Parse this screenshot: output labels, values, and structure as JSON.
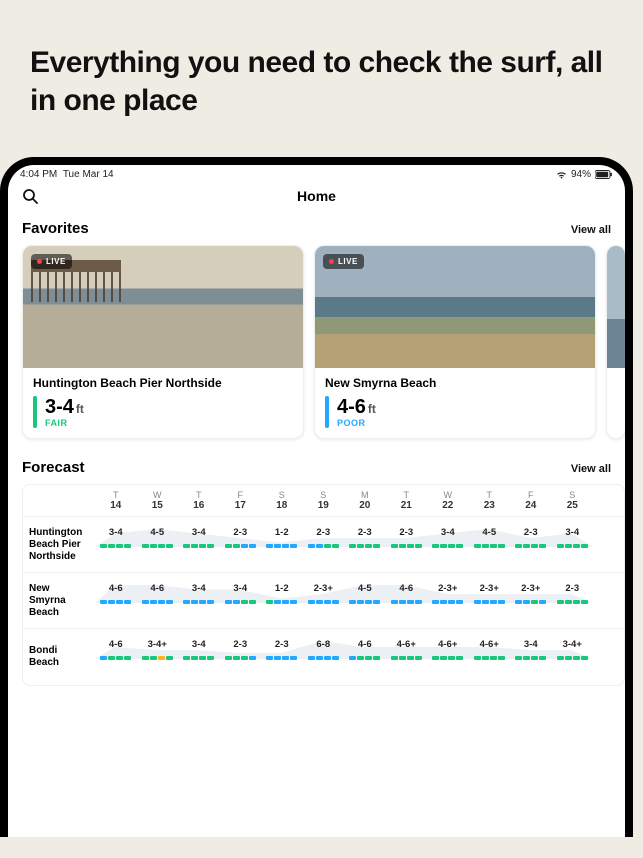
{
  "headline": "Everything you need to check the surf, all in one place",
  "status": {
    "time": "4:04 PM",
    "date": "Tue Mar 14",
    "battery": "94%"
  },
  "nav": {
    "title": "Home"
  },
  "favorites": {
    "title": "Favorites",
    "view_all": "View all",
    "live_label": "LIVE",
    "cards": [
      {
        "name": "Huntington Beach Pier Northside",
        "height": "3-4",
        "unit": "ft",
        "condition": "FAIR",
        "cond_key": "fair"
      },
      {
        "name": "New Smyrna Beach",
        "height": "4-6",
        "unit": "ft",
        "condition": "POOR",
        "cond_key": "poor"
      }
    ]
  },
  "forecast": {
    "title": "Forecast",
    "view_all": "View all",
    "days": [
      {
        "dow": "T",
        "dom": "14"
      },
      {
        "dow": "W",
        "dom": "15"
      },
      {
        "dow": "T",
        "dom": "16"
      },
      {
        "dow": "F",
        "dom": "17"
      },
      {
        "dow": "S",
        "dom": "18"
      },
      {
        "dow": "S",
        "dom": "19"
      },
      {
        "dow": "M",
        "dom": "20"
      },
      {
        "dow": "T",
        "dom": "21"
      },
      {
        "dow": "W",
        "dom": "22"
      },
      {
        "dow": "T",
        "dom": "23"
      },
      {
        "dow": "F",
        "dom": "24"
      },
      {
        "dow": "S",
        "dom": "25"
      }
    ],
    "spots": [
      {
        "name": "Huntington Beach Pier Northside",
        "cells": [
          {
            "v": "3-4",
            "c": [
              "g",
              "g",
              "g",
              "g"
            ]
          },
          {
            "v": "4-5",
            "c": [
              "g",
              "g",
              "g",
              "g"
            ]
          },
          {
            "v": "3-4",
            "c": [
              "g",
              "g",
              "g",
              "g"
            ]
          },
          {
            "v": "2-3",
            "c": [
              "g",
              "g",
              "b",
              "b"
            ]
          },
          {
            "v": "1-2",
            "c": [
              "b",
              "b",
              "b",
              "b"
            ]
          },
          {
            "v": "2-3",
            "c": [
              "b",
              "b",
              "g",
              "g"
            ]
          },
          {
            "v": "2-3",
            "c": [
              "g",
              "g",
              "g",
              "g"
            ]
          },
          {
            "v": "2-3",
            "c": [
              "g",
              "g",
              "g",
              "g"
            ]
          },
          {
            "v": "3-4",
            "c": [
              "g",
              "g",
              "g",
              "g"
            ]
          },
          {
            "v": "4-5",
            "c": [
              "g",
              "g",
              "g",
              "g"
            ]
          },
          {
            "v": "2-3",
            "c": [
              "g",
              "g",
              "g",
              "g"
            ]
          },
          {
            "v": "3-4",
            "c": [
              "g",
              "g",
              "g",
              "g"
            ]
          }
        ]
      },
      {
        "name": "New Smyrna Beach",
        "cells": [
          {
            "v": "4-6",
            "c": [
              "b",
              "b",
              "b",
              "b"
            ]
          },
          {
            "v": "4-6",
            "c": [
              "b",
              "b",
              "b",
              "b"
            ]
          },
          {
            "v": "3-4",
            "c": [
              "b",
              "b",
              "b",
              "b"
            ]
          },
          {
            "v": "3-4",
            "c": [
              "b",
              "b",
              "g",
              "g"
            ]
          },
          {
            "v": "1-2",
            "c": [
              "g",
              "b",
              "b",
              "b"
            ]
          },
          {
            "v": "2-3+",
            "c": [
              "b",
              "b",
              "b",
              "b"
            ]
          },
          {
            "v": "4-5",
            "c": [
              "b",
              "b",
              "b",
              "b"
            ]
          },
          {
            "v": "4-6",
            "c": [
              "b",
              "b",
              "b",
              "b"
            ]
          },
          {
            "v": "2-3+",
            "c": [
              "b",
              "b",
              "b",
              "b"
            ]
          },
          {
            "v": "2-3+",
            "c": [
              "b",
              "b",
              "b",
              "b"
            ]
          },
          {
            "v": "2-3+",
            "c": [
              "b",
              "b",
              "g",
              "b"
            ]
          },
          {
            "v": "2-3",
            "c": [
              "g",
              "g",
              "g",
              "g"
            ]
          }
        ]
      },
      {
        "name": "Bondi Beach",
        "cells": [
          {
            "v": "4-6",
            "c": [
              "b",
              "g",
              "g",
              "g"
            ]
          },
          {
            "v": "3-4+",
            "c": [
              "g",
              "g",
              "o",
              "g"
            ]
          },
          {
            "v": "3-4",
            "c": [
              "g",
              "g",
              "g",
              "g"
            ]
          },
          {
            "v": "2-3",
            "c": [
              "g",
              "g",
              "g",
              "b"
            ]
          },
          {
            "v": "2-3",
            "c": [
              "b",
              "b",
              "b",
              "b"
            ]
          },
          {
            "v": "6-8",
            "c": [
              "b",
              "b",
              "b",
              "b"
            ]
          },
          {
            "v": "4-6",
            "c": [
              "b",
              "g",
              "g",
              "g"
            ]
          },
          {
            "v": "4-6+",
            "c": [
              "g",
              "g",
              "g",
              "g"
            ]
          },
          {
            "v": "4-6+",
            "c": [
              "g",
              "g",
              "g",
              "g"
            ]
          },
          {
            "v": "4-6+",
            "c": [
              "g",
              "g",
              "g",
              "g"
            ]
          },
          {
            "v": "3-4",
            "c": [
              "g",
              "g",
              "g",
              "g"
            ]
          },
          {
            "v": "3-4+",
            "c": [
              "g",
              "g",
              "g",
              "g"
            ]
          }
        ]
      }
    ]
  }
}
